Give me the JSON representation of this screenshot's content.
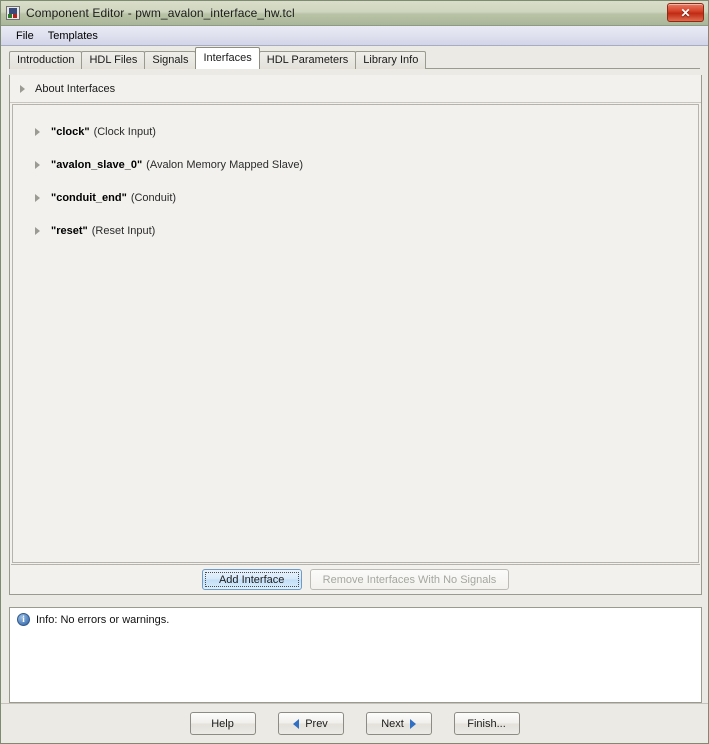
{
  "window": {
    "title": "Component Editor - pwm_avalon_interface_hw.tcl",
    "app_icon": "component-editor-icon",
    "close_label": "✕"
  },
  "menubar": {
    "items": [
      {
        "label": "File"
      },
      {
        "label": "Templates"
      }
    ]
  },
  "tabs": [
    {
      "label": "Introduction",
      "selected": false
    },
    {
      "label": "HDL Files",
      "selected": false
    },
    {
      "label": "Signals",
      "selected": false
    },
    {
      "label": "Interfaces",
      "selected": true
    },
    {
      "label": "HDL Parameters",
      "selected": false
    },
    {
      "label": "Library Info",
      "selected": false
    }
  ],
  "about": {
    "label": "About Interfaces"
  },
  "interfaces": [
    {
      "name": "\"clock\"",
      "kind": "(Clock Input)"
    },
    {
      "name": "\"avalon_slave_0\"",
      "kind": "(Avalon Memory Mapped Slave)"
    },
    {
      "name": "\"conduit_end\"",
      "kind": "(Conduit)"
    },
    {
      "name": "\"reset\"",
      "kind": "(Reset Input)"
    }
  ],
  "card_actions": {
    "add_interface_label": "Add Interface",
    "remove_interfaces_label": "Remove Interfaces With No Signals",
    "remove_interfaces_enabled": false
  },
  "info": {
    "icon": "information-icon",
    "icon_glyph": "i",
    "text": "Info: No errors or warnings."
  },
  "footer": {
    "help_label": "Help",
    "prev_label": "Prev",
    "next_label": "Next",
    "finish_label": "Finish..."
  },
  "colors": {
    "titlebar_start": "#d9ddc9",
    "titlebar_end": "#aab69a",
    "close_button": "#c02a14",
    "accent_blue": "#2f6fc4",
    "focus_blue": "#c3dff7",
    "panel_bg": "#f2f1ed",
    "info_panel_bg": "#ffffff"
  }
}
